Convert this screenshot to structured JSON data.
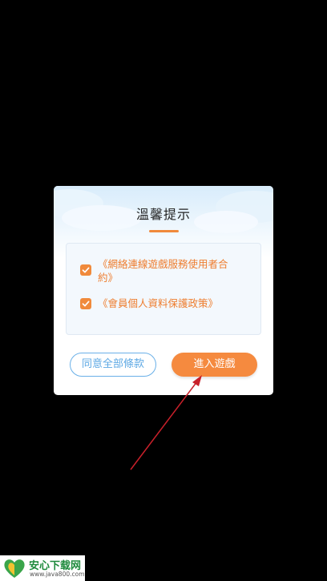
{
  "dialog": {
    "title": "溫馨提示",
    "terms": [
      {
        "label": "《網絡連線遊戲服務使用者合約》",
        "checked": true
      },
      {
        "label": "《會員個人資料保護政策》",
        "checked": true
      }
    ],
    "agree_all_label": "同意全部條款",
    "enter_game_label": "進入遊戲"
  },
  "watermark": {
    "title": "安心下载网",
    "url": "www.java800.com"
  },
  "colors": {
    "accent_orange": "#f58a3f",
    "link_blue": "#5da8e4",
    "arrow_red": "#c8202a",
    "background": "#000000"
  },
  "icons": [
    "checkmark-icon",
    "cloud-decoration",
    "annotation-arrow",
    "watermark-logo-icon"
  ]
}
